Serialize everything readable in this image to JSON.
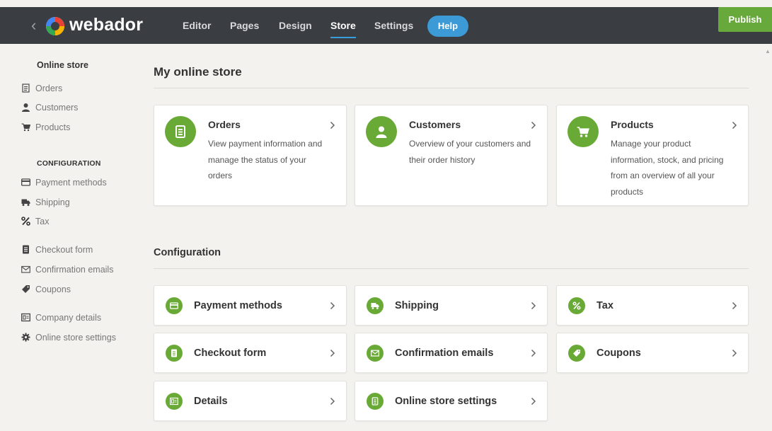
{
  "topbar": {
    "brand": "webador",
    "nav": [
      {
        "label": "Editor",
        "active": false
      },
      {
        "label": "Pages",
        "active": false
      },
      {
        "label": "Design",
        "active": false
      },
      {
        "label": "Store",
        "active": true
      },
      {
        "label": "Settings",
        "active": false
      }
    ],
    "help_label": "Help",
    "publish_label": "Publish",
    "colors": {
      "bar": "#3a3d42",
      "help": "#3c9bd6",
      "publish": "#67a93b",
      "accent": "#69aa37"
    }
  },
  "sidebar": {
    "section_online_store": "Online store",
    "online_items": [
      {
        "label": "Orders",
        "icon": "orders-icon"
      },
      {
        "label": "Customers",
        "icon": "customers-icon"
      },
      {
        "label": "Products",
        "icon": "cart-icon"
      }
    ],
    "section_config": "CONFIGURATION",
    "config_items": [
      {
        "label": "Payment methods",
        "icon": "credit-card-icon"
      },
      {
        "label": "Shipping",
        "icon": "truck-icon"
      },
      {
        "label": "Tax",
        "icon": "percent-icon"
      },
      {
        "label": "Checkout form",
        "icon": "form-icon"
      },
      {
        "label": "Confirmation emails",
        "icon": "envelope-icon"
      },
      {
        "label": "Coupons",
        "icon": "tag-icon"
      },
      {
        "label": "Company details",
        "icon": "id-card-icon"
      },
      {
        "label": "Online store settings",
        "icon": "gear-icon"
      }
    ]
  },
  "main": {
    "title": "My online store",
    "overview_cards": [
      {
        "title": "Orders",
        "description": "View payment information and manage the status of your orders",
        "icon": "orders-icon"
      },
      {
        "title": "Customers",
        "description": "Overview of your customers and their order history",
        "icon": "customers-icon"
      },
      {
        "title": "Products",
        "description": "Manage your product information, stock, and pricing from an overview of all your products",
        "icon": "cart-icon"
      }
    ],
    "config_title": "Configuration",
    "config_cards": [
      {
        "title": "Payment methods",
        "icon": "credit-card-icon"
      },
      {
        "title": "Shipping",
        "icon": "truck-icon"
      },
      {
        "title": "Tax",
        "icon": "percent-icon"
      },
      {
        "title": "Checkout form",
        "icon": "form-icon"
      },
      {
        "title": "Confirmation emails",
        "icon": "envelope-icon"
      },
      {
        "title": "Coupons",
        "icon": "tag-icon"
      },
      {
        "title": "Details",
        "icon": "id-card-icon"
      },
      {
        "title": "Online store settings",
        "icon": "orders-icon"
      }
    ]
  }
}
